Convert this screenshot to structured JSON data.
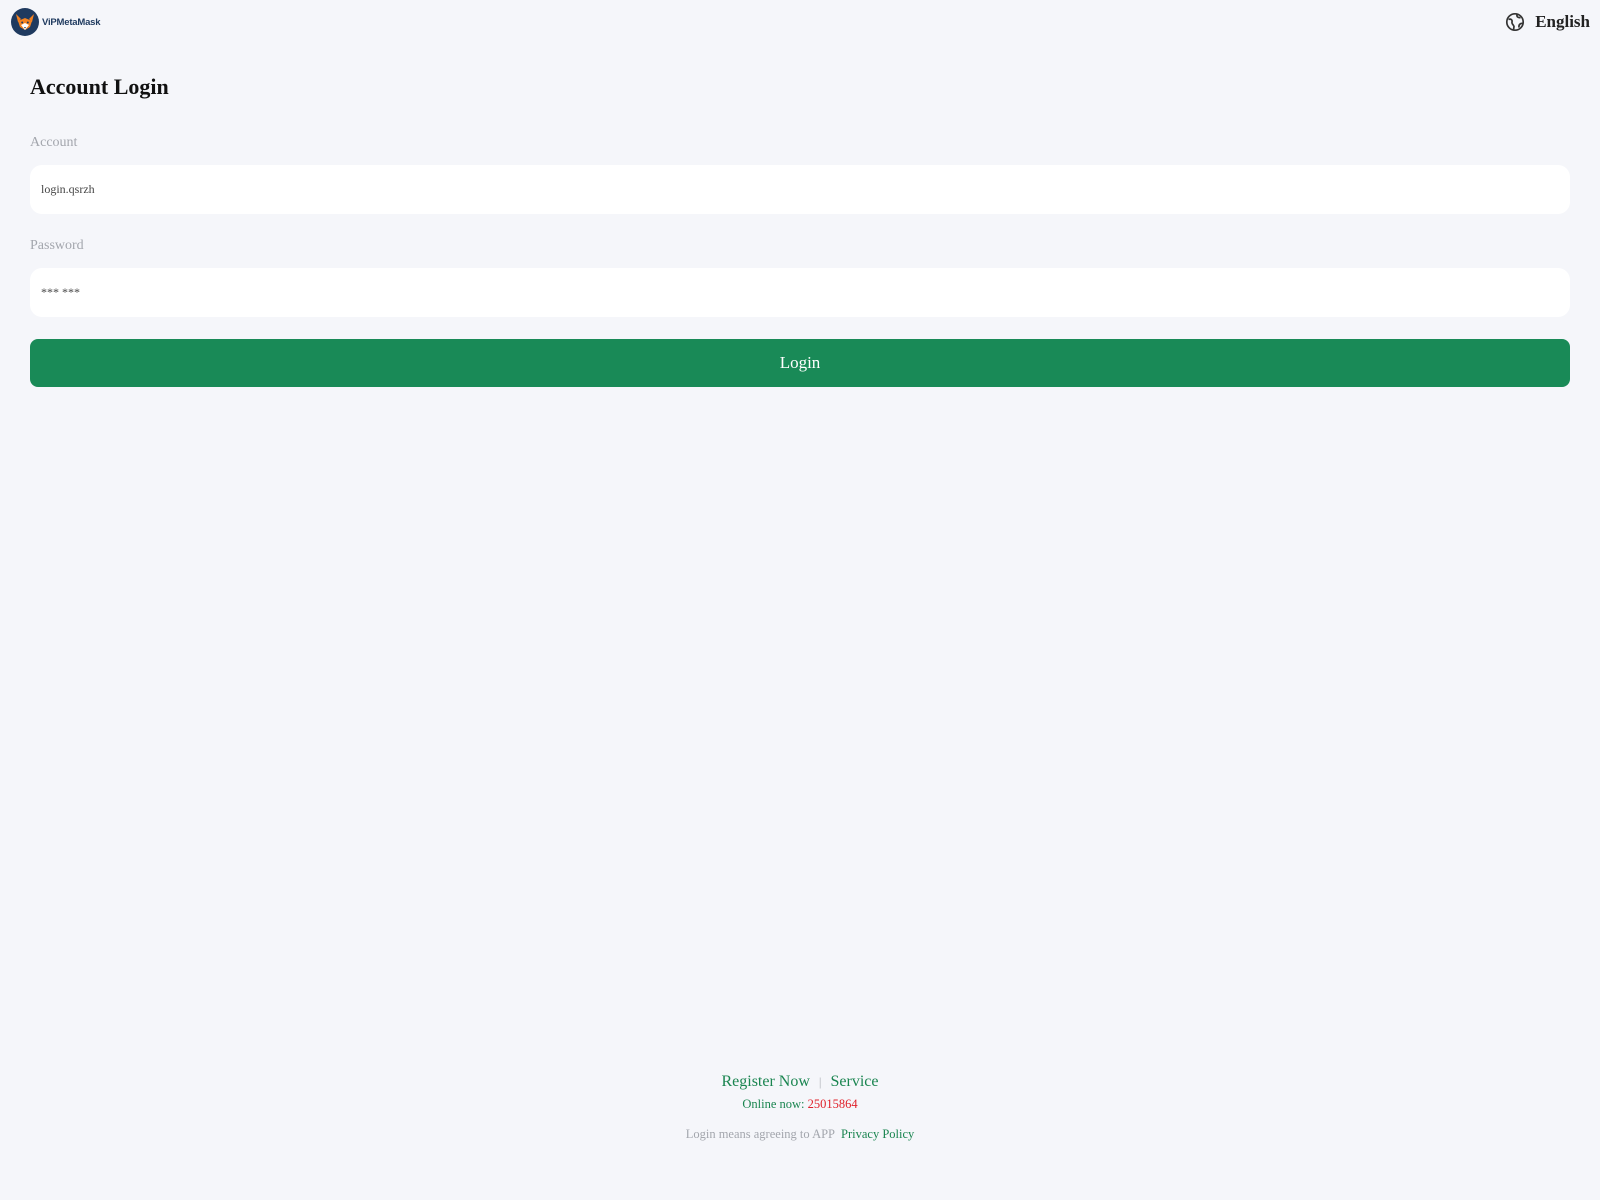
{
  "header": {
    "brand_name": "ViPMetaMask",
    "logo_icon": "fox-logo-icon",
    "language_icon": "globe-icon",
    "language_label": "English"
  },
  "form": {
    "title": "Account Login",
    "account_label": "Account",
    "account_value": "login.qsrzh",
    "password_label": "Password",
    "password_value": "*** ***",
    "login_label": "Login"
  },
  "footer": {
    "register_label": "Register Now",
    "separator": "|",
    "service_label": "Service",
    "online_label": "Online now: ",
    "online_count": "25015864",
    "agreement_text": "Login means agreeing to APP",
    "policy_label": "Privacy Policy"
  },
  "colors": {
    "background": "#f5f6fa",
    "accent_green": "#198a57",
    "link_green": "#1a8550",
    "count_red": "#e0212b",
    "brand_navy": "#1f3a5f"
  }
}
